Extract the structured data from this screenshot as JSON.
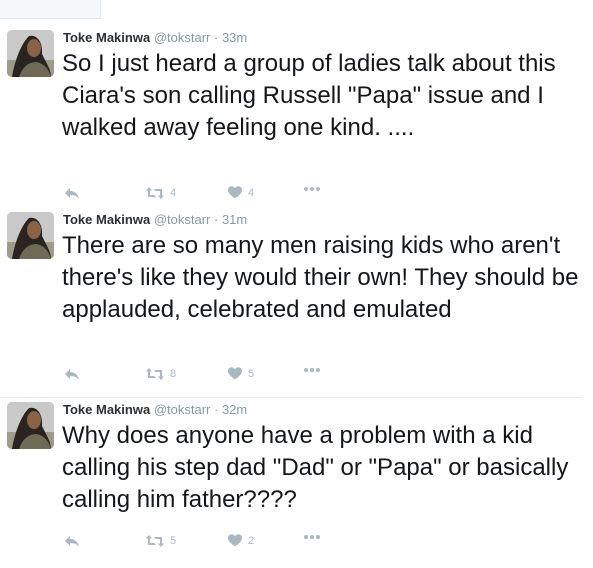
{
  "colors": {
    "icon": "#aab8c2",
    "meta": "#8899a6",
    "name": "#292f33",
    "text": "#14171a",
    "divider": "#e6ecf0"
  },
  "icons": [
    "reply-icon",
    "retweet-icon",
    "heart-icon",
    "more-icon"
  ],
  "tweets": [
    {
      "name": "Toke Makinwa",
      "handle": "@tokstarr",
      "sep": "·",
      "time": "33m",
      "text": "So I just heard a group of ladies talk about this Ciara's son calling Russell \"Papa\" issue and I walked away feeling one kind. ....",
      "retweets": "4",
      "likes": "4"
    },
    {
      "name": "Toke Makinwa",
      "handle": "@tokstarr",
      "sep": "·",
      "time": "31m",
      "text": "There are so many men raising kids who aren't there's like they would their own! They should be applauded, celebrated and emulated",
      "retweets": "8",
      "likes": "5"
    },
    {
      "name": "Toke Makinwa",
      "handle": "@tokstarr",
      "sep": "·",
      "time": "32m",
      "text": "Why does anyone have a problem with a kid calling his step dad \"Dad\" or \"Papa\" or basically calling him father????",
      "retweets": "5",
      "likes": "2"
    }
  ]
}
